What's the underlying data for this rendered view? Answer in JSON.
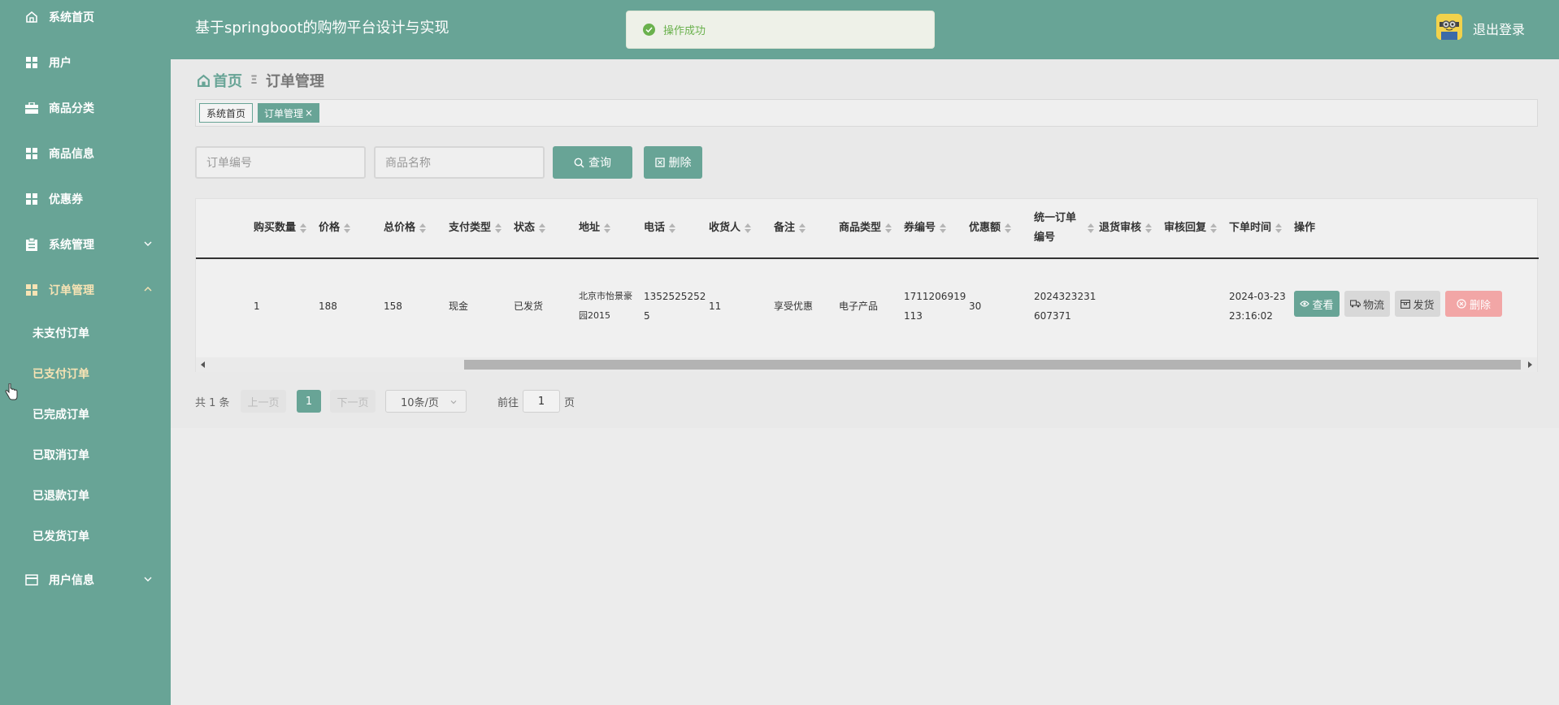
{
  "app": {
    "title": "基于springboot的购物平台设计与实现",
    "logout": "退出登录"
  },
  "toast": {
    "message": "操作成功"
  },
  "sidebar": {
    "items": [
      {
        "label": "系统首页",
        "icon": "home-icon"
      },
      {
        "label": "用户",
        "icon": "grid-icon"
      },
      {
        "label": "商品分类",
        "icon": "briefcase-icon"
      },
      {
        "label": "商品信息",
        "icon": "grid-icon"
      },
      {
        "label": "优惠券",
        "icon": "grid-icon"
      },
      {
        "label": "系统管理",
        "icon": "clipboard-icon"
      },
      {
        "label": "订单管理",
        "icon": "grid-icon"
      },
      {
        "label": "用户信息",
        "icon": "card-icon"
      }
    ],
    "sub_items": [
      "未支付订单",
      "已支付订单",
      "已完成订单",
      "已取消订单",
      "已退款订单",
      "已发货订单"
    ]
  },
  "breadcrumb": {
    "home": "首页",
    "sep": "Ξ",
    "current": "订单管理"
  },
  "tags": {
    "home": "系统首页",
    "current": "订单管理",
    "close": "×"
  },
  "search": {
    "order_no_placeholder": "订单编号",
    "product_placeholder": "商品名称",
    "query_label": "查询",
    "delete_label": "删除"
  },
  "table": {
    "headers": [
      "购买数量",
      "价格",
      "总价格",
      "支付类型",
      "状态",
      "地址",
      "电话",
      "收货人",
      "备注",
      "商品类型",
      "券编号",
      "优惠额",
      "统一订单",
      "编号",
      "退货审核",
      "审核回复",
      "下单时间",
      "操作"
    ],
    "row": {
      "qty": "1",
      "price": "188",
      "total": "158",
      "pay_type": "现金",
      "status": "已发货",
      "address_1": "北京市怡景豪",
      "address_2": "园2015",
      "phone_1": "1352525252",
      "phone_2": "5",
      "receiver": "11",
      "remark": "享受优惠",
      "category": "电子产品",
      "coupon_1": "1711206919",
      "coupon_2": "113",
      "discount": "30",
      "unified_1": "2024323231",
      "unified_2": "607371",
      "time_1": "2024-03-23",
      "time_2": "23:16:02"
    },
    "actions": {
      "view": "查看",
      "logistics": "物流",
      "ship": "发货",
      "delete": "删除"
    }
  },
  "pagination": {
    "total": "共 1 条",
    "prev": "上一页",
    "page": "1",
    "next": "下一页",
    "size": "10条/页",
    "goto_pre": "前往",
    "goto_value": "1",
    "goto_post": "页"
  },
  "colors": {
    "primary": "#68a496",
    "active_menu": "#f7e3b4",
    "danger": "#f2a6a6",
    "success": "#6ab14d"
  }
}
